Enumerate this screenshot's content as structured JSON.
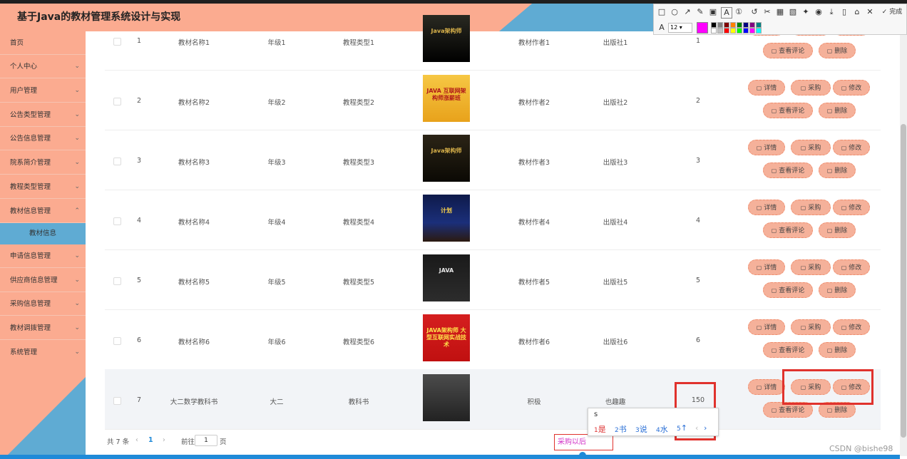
{
  "app": {
    "title": "基于Java的教材管理系统设计与实现"
  },
  "sidebar": {
    "items": [
      {
        "label": "首页",
        "has_arrow": false
      },
      {
        "label": "个人中心",
        "has_arrow": true
      },
      {
        "label": "用户管理",
        "has_arrow": true
      },
      {
        "label": "公告类型管理",
        "has_arrow": true
      },
      {
        "label": "公告信息管理",
        "has_arrow": true
      },
      {
        "label": "院系简介管理",
        "has_arrow": true
      },
      {
        "label": "教程类型管理",
        "has_arrow": true
      },
      {
        "label": "教材信息管理",
        "has_arrow": true
      },
      {
        "label": "申请信息管理",
        "has_arrow": true
      },
      {
        "label": "供应商信息管理",
        "has_arrow": true
      },
      {
        "label": "采购信息管理",
        "has_arrow": true
      },
      {
        "label": "教材调拨管理",
        "has_arrow": true
      },
      {
        "label": "系统管理",
        "has_arrow": true
      }
    ],
    "active_sub": "教材信息"
  },
  "table": {
    "rows": [
      {
        "index": "1",
        "name": "教材名称1",
        "grade": "年级1",
        "type": "教程类型1",
        "author": "教材作者1",
        "publisher": "出版社1",
        "qty": "1",
        "thumb_text": "Java架构师"
      },
      {
        "index": "2",
        "name": "教材名称2",
        "grade": "年级2",
        "type": "教程类型2",
        "author": "教材作者2",
        "publisher": "出版社2",
        "qty": "2",
        "thumb_text": "JAVA 互联网架构师涨薪班"
      },
      {
        "index": "3",
        "name": "教材名称3",
        "grade": "年级3",
        "type": "教程类型3",
        "author": "教材作者3",
        "publisher": "出版社3",
        "qty": "3",
        "thumb_text": "Java架构师"
      },
      {
        "index": "4",
        "name": "教材名称4",
        "grade": "年级4",
        "type": "教程类型4",
        "author": "教材作者4",
        "publisher": "出版社4",
        "qty": "4",
        "thumb_text": "计划"
      },
      {
        "index": "5",
        "name": "教材名称5",
        "grade": "年级5",
        "type": "教程类型5",
        "author": "教材作者5",
        "publisher": "出版社5",
        "qty": "5",
        "thumb_text": "JAVA"
      },
      {
        "index": "6",
        "name": "教材名称6",
        "grade": "年级6",
        "type": "教程类型6",
        "author": "教材作者6",
        "publisher": "出版社6",
        "qty": "6",
        "thumb_text": "JAVA架构师 大型互联网实战技术"
      },
      {
        "index": "7",
        "name": "大二数学教科书",
        "grade": "大二",
        "type": "教科书",
        "author": "积极",
        "publisher": "也趣趣",
        "qty": "150",
        "thumb_text": ""
      }
    ],
    "actions": {
      "detail": "详情",
      "purchase": "采购",
      "edit": "修改",
      "comments": "查看评论",
      "delete": "删除"
    }
  },
  "pagination": {
    "total": "共 7 条",
    "prev": "‹",
    "page": "1",
    "next": "›",
    "goto": "前往",
    "goto_value": "1",
    "unit": "页"
  },
  "toolbar": {
    "font_size": "12",
    "done_label": "完成",
    "colors": {
      "current": "#ff00ff"
    }
  },
  "ime": {
    "input": "s",
    "candidates": [
      {
        "num": "1",
        "text": "是"
      },
      {
        "num": "2",
        "text": "书"
      },
      {
        "num": "3",
        "text": "说"
      },
      {
        "num": "4",
        "text": "水"
      },
      {
        "num": "5",
        "text": "↑"
      }
    ]
  },
  "annotation": {
    "note": "采购以后"
  },
  "watermark": "CSDN @bishe98",
  "palette": {
    "salmon": "#fbab90",
    "blue": "#5fabd3",
    "button": "#f5b19a",
    "highlight_red": "#e0322d"
  }
}
